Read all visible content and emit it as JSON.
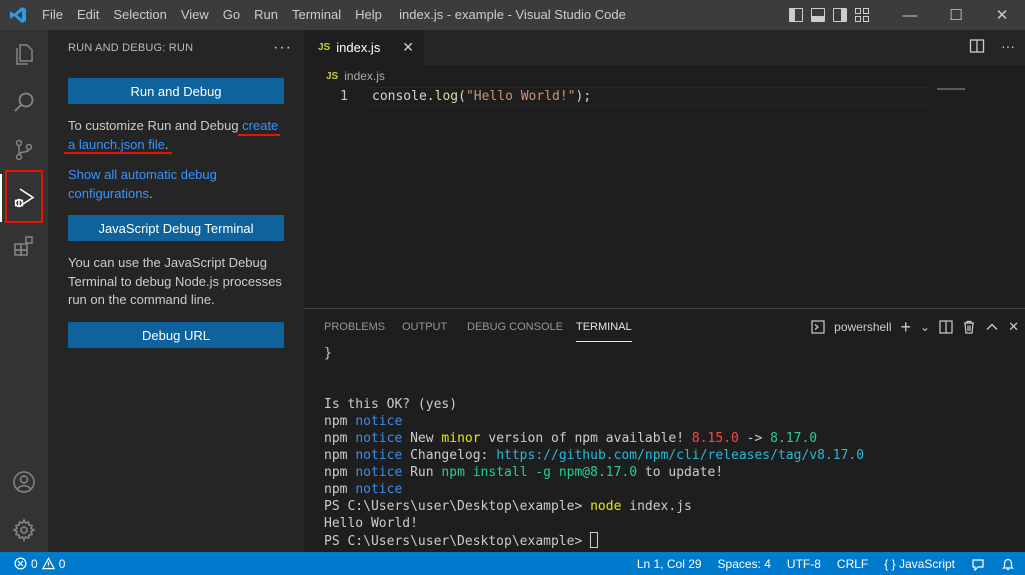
{
  "titlebar": {
    "menu": [
      "File",
      "Edit",
      "Selection",
      "View",
      "Go",
      "Run",
      "Terminal",
      "Help"
    ],
    "title": "index.js - example - Visual Studio Code",
    "minimize": "—",
    "maximize": "☐",
    "close": "✕"
  },
  "sidebar": {
    "header": "RUN AND DEBUG: RUN",
    "more": "···",
    "run_debug_button": "Run and Debug",
    "customize_text": "To customize Run and Debug ",
    "customize_link_1": "create",
    "customize_link_2": "a launch.json file",
    "customize_end": ".",
    "show_all_1": "Show all automatic debug",
    "show_all_2": "configurations",
    "show_all_end": ".",
    "js_terminal_button": "JavaScript Debug Terminal",
    "js_terminal_text": "You can use the JavaScript Debug Terminal to debug Node.js processes run on the command line.",
    "debug_url_button": "Debug URL"
  },
  "editor": {
    "tab_badge": "JS",
    "tab_label": "index.js",
    "tab_close": "✕",
    "breadcrumb_badge": "JS",
    "breadcrumb": "index.js",
    "line_number": "1",
    "code_obj": "console.",
    "code_fn": "log",
    "code_open": "(",
    "code_str": "\"Hello World!\"",
    "code_close": ");"
  },
  "panel": {
    "tabs": [
      "PROBLEMS",
      "OUTPUT",
      "DEBUG CONSOLE",
      "TERMINAL"
    ],
    "active_tab": "TERMINAL",
    "shell": "powershell",
    "plus": "+",
    "chevron": "⌄",
    "close": "✕"
  },
  "terminal": {
    "brace": "}",
    "ok": "Is this OK? (yes)",
    "npm": "npm",
    "notice": "notice",
    "new_text_1": "New ",
    "minor": "minor",
    "new_text_2": " version of npm available! ",
    "ver_old": "8.15.0",
    "arrow": " -> ",
    "ver_new": "8.17.0",
    "changelog_label": "Changelog: ",
    "changelog_url": "https://github.com/npm/cli/releases/tag/v8.17.0",
    "run_label": "Run ",
    "run_cmd": "npm install -g npm@8.17.0",
    "run_end": " to update!",
    "prompt": "PS C:\\Users\\user\\Desktop\\example> ",
    "node_cmd": "node",
    "node_arg": " index.js",
    "output": "Hello World!"
  },
  "statusbar": {
    "errors": "0",
    "warnings": "0",
    "position": "Ln 1, Col 29",
    "spaces": "Spaces: 4",
    "encoding": "UTF-8",
    "eol": "CRLF",
    "language": "JavaScript",
    "language_icon": "{ }"
  },
  "colors": {
    "accent": "#007acc",
    "button": "#0e639c",
    "link": "#3794ff",
    "highlight": "#e51400"
  }
}
